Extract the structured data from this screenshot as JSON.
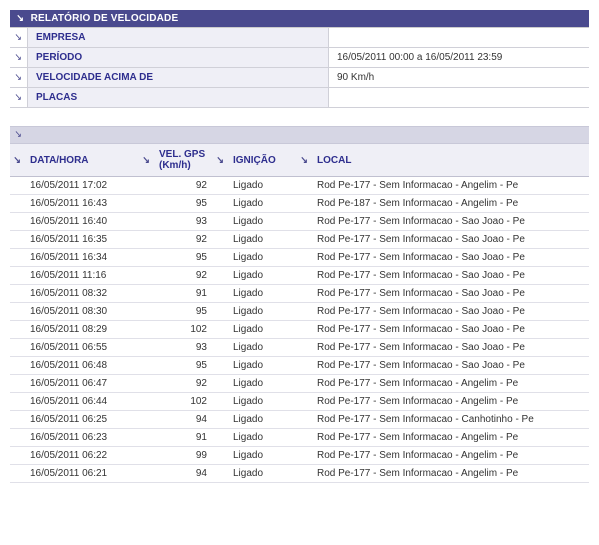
{
  "report": {
    "title": "RELATÓRIO DE VELOCIDADE",
    "params": [
      {
        "label": "EMPRESA",
        "value": ""
      },
      {
        "label": "PERÍODO",
        "value": "16/05/2011 00:00 a 16/05/2011 23:59"
      },
      {
        "label": "VELOCIDADE ACIMA DE",
        "value": "90 Km/h"
      },
      {
        "label": "PLACAS",
        "value": ""
      }
    ]
  },
  "table": {
    "headers": {
      "datahora": "DATA/HORA",
      "vel": "VEL. GPS (Km/h)",
      "ignicao": "IGNIÇÃO",
      "local": "LOCAL"
    },
    "rows": [
      {
        "datahora": "16/05/2011 17:02",
        "vel": "92",
        "ignicao": "Ligado",
        "local": "Rod Pe-177 - Sem Informacao - Angelim - Pe"
      },
      {
        "datahora": "16/05/2011 16:43",
        "vel": "95",
        "ignicao": "Ligado",
        "local": "Rod Pe-187 - Sem Informacao - Angelim - Pe"
      },
      {
        "datahora": "16/05/2011 16:40",
        "vel": "93",
        "ignicao": "Ligado",
        "local": "Rod Pe-177 - Sem Informacao - Sao Joao - Pe"
      },
      {
        "datahora": "16/05/2011 16:35",
        "vel": "92",
        "ignicao": "Ligado",
        "local": "Rod Pe-177 - Sem Informacao - Sao Joao - Pe"
      },
      {
        "datahora": "16/05/2011 16:34",
        "vel": "95",
        "ignicao": "Ligado",
        "local": "Rod Pe-177 - Sem Informacao - Sao Joao - Pe"
      },
      {
        "datahora": "16/05/2011 11:16",
        "vel": "92",
        "ignicao": "Ligado",
        "local": "Rod Pe-177 - Sem Informacao - Sao Joao - Pe"
      },
      {
        "datahora": "16/05/2011 08:32",
        "vel": "91",
        "ignicao": "Ligado",
        "local": "Rod Pe-177 - Sem Informacao - Sao Joao - Pe"
      },
      {
        "datahora": "16/05/2011 08:30",
        "vel": "95",
        "ignicao": "Ligado",
        "local": "Rod Pe-177 - Sem Informacao - Sao Joao - Pe"
      },
      {
        "datahora": "16/05/2011 08:29",
        "vel": "102",
        "ignicao": "Ligado",
        "local": "Rod Pe-177 - Sem Informacao - Sao Joao - Pe"
      },
      {
        "datahora": "16/05/2011 06:55",
        "vel": "93",
        "ignicao": "Ligado",
        "local": "Rod Pe-177 - Sem Informacao - Sao Joao - Pe"
      },
      {
        "datahora": "16/05/2011 06:48",
        "vel": "95",
        "ignicao": "Ligado",
        "local": "Rod Pe-177 - Sem Informacao - Sao Joao - Pe"
      },
      {
        "datahora": "16/05/2011 06:47",
        "vel": "92",
        "ignicao": "Ligado",
        "local": "Rod Pe-177 - Sem Informacao - Angelim - Pe"
      },
      {
        "datahora": "16/05/2011 06:44",
        "vel": "102",
        "ignicao": "Ligado",
        "local": "Rod Pe-177 - Sem Informacao - Angelim - Pe"
      },
      {
        "datahora": "16/05/2011 06:25",
        "vel": "94",
        "ignicao": "Ligado",
        "local": "Rod Pe-177 - Sem Informacao - Canhotinho - Pe"
      },
      {
        "datahora": "16/05/2011 06:23",
        "vel": "91",
        "ignicao": "Ligado",
        "local": "Rod Pe-177 - Sem Informacao - Angelim - Pe"
      },
      {
        "datahora": "16/05/2011 06:22",
        "vel": "99",
        "ignicao": "Ligado",
        "local": "Rod Pe-177 - Sem Informacao - Angelim - Pe"
      },
      {
        "datahora": "16/05/2011 06:21",
        "vel": "94",
        "ignicao": "Ligado",
        "local": "Rod Pe-177 - Sem Informacao - Angelim - Pe"
      }
    ]
  }
}
